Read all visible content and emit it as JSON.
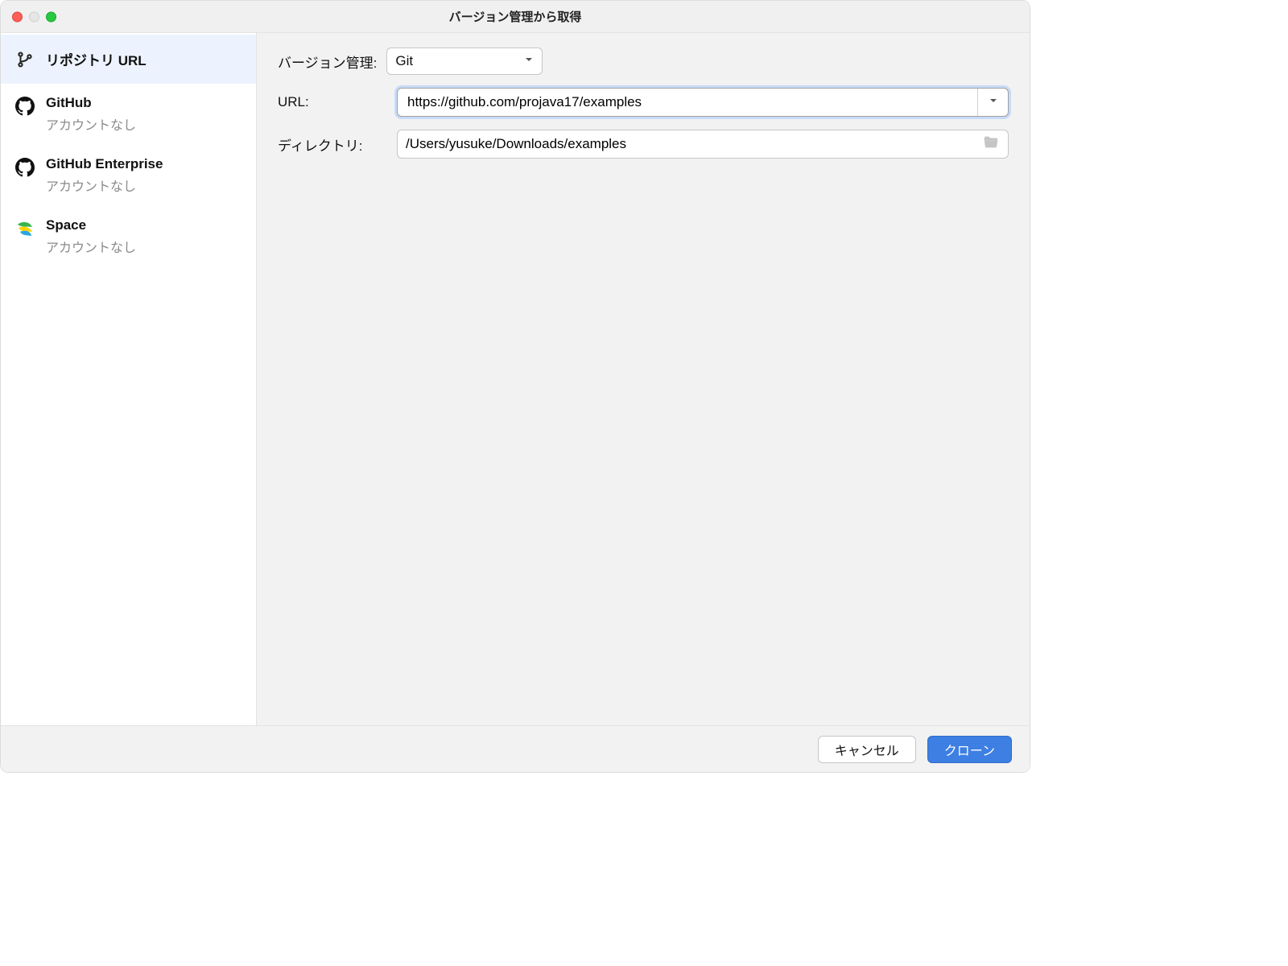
{
  "window": {
    "title": "バージョン管理から取得"
  },
  "sidebar": {
    "items": [
      {
        "icon": "branch",
        "label": "リポジトリ URL"
      },
      {
        "icon": "github",
        "label": "GitHub",
        "sub": "アカウントなし"
      },
      {
        "icon": "github",
        "label": "GitHub Enterprise",
        "sub": "アカウントなし"
      },
      {
        "icon": "space",
        "label": "Space",
        "sub": "アカウントなし"
      }
    ]
  },
  "form": {
    "vcs_label": "バージョン管理:",
    "vcs_value": "Git",
    "url_label": "URL:",
    "url_value": "https://github.com/projava17/examples",
    "dir_label": "ディレクトリ:",
    "dir_value": "/Users/yusuke/Downloads/examples"
  },
  "footer": {
    "cancel": "キャンセル",
    "clone": "クローン"
  }
}
